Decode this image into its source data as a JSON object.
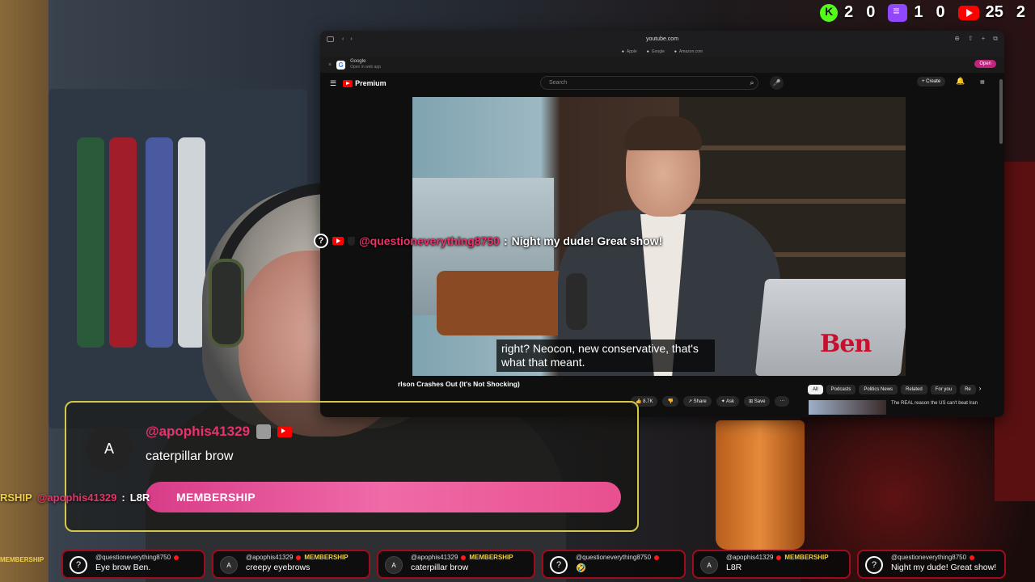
{
  "stats": {
    "kick": {
      "icon": "kick-icon",
      "followers": "2",
      "viewers": "0"
    },
    "twitch": {
      "icon": "twitch-icon",
      "followers": "1",
      "viewers": "0"
    },
    "youtube": {
      "icon": "youtube-icon",
      "followers": "25",
      "viewers": "2"
    }
  },
  "browser": {
    "url": "youtube.com",
    "bookmarks": [
      "Apple",
      "Google",
      "Amazon.com"
    ],
    "google_bar": {
      "title": "Google",
      "subtitle": "Open in web app",
      "open_label": "Open"
    },
    "youtube": {
      "logo_label": "Premium",
      "search_placeholder": "Search",
      "create_label": "+ Create",
      "video": {
        "subtitle": "right? Neocon, new conservative, that's what that meant.",
        "brand": "Ben",
        "title": "rlson Crashes Out (It's Not Shocking)"
      },
      "actions": [
        "👍 8.7K",
        "👎",
        "↗ Share",
        "✦ Ask",
        "⊞ Save",
        "···"
      ],
      "chips": [
        {
          "label": "All",
          "selected": true
        },
        {
          "label": "Podcasts",
          "selected": false
        },
        {
          "label": "Politics News",
          "selected": false
        },
        {
          "label": "Related",
          "selected": false
        },
        {
          "label": "For you",
          "selected": false
        },
        {
          "label": "Re",
          "selected": false
        }
      ],
      "recommendation": "The REAL reason the US can't beat Iran"
    }
  },
  "floating_chat": {
    "user": "@questioneverything8750",
    "message": "Night my dude! Great show!"
  },
  "highlight": {
    "avatar_letter": "A",
    "user": "@apophis41329",
    "message": "caterpillar brow",
    "bar_label": "MEMBERSHIP",
    "side_prefix": "RSHIP",
    "side_user": "@apophis41329",
    "side_message": "L8R"
  },
  "ticker": {
    "edge_label": "MEMBERSHIP",
    "items": [
      {
        "avatar": "?",
        "user": "@questioneverything8750",
        "member": "",
        "message": "Eye brow Ben."
      },
      {
        "avatar": "A",
        "user": "@apophis41329",
        "member": "MEMBERSHIP",
        "message": "creepy eyebrows"
      },
      {
        "avatar": "A",
        "user": "@apophis41329",
        "member": "MEMBERSHIP",
        "message": "caterpillar brow"
      },
      {
        "avatar": "?",
        "user": "@questioneverything8750",
        "member": "",
        "message": "🤣"
      },
      {
        "avatar": "A",
        "user": "@apophis41329",
        "member": "MEMBERSHIP",
        "message": "L8R"
      },
      {
        "avatar": "?",
        "user": "@questioneverything8750",
        "member": "",
        "message": "Night my dude! Great show!"
      }
    ]
  }
}
